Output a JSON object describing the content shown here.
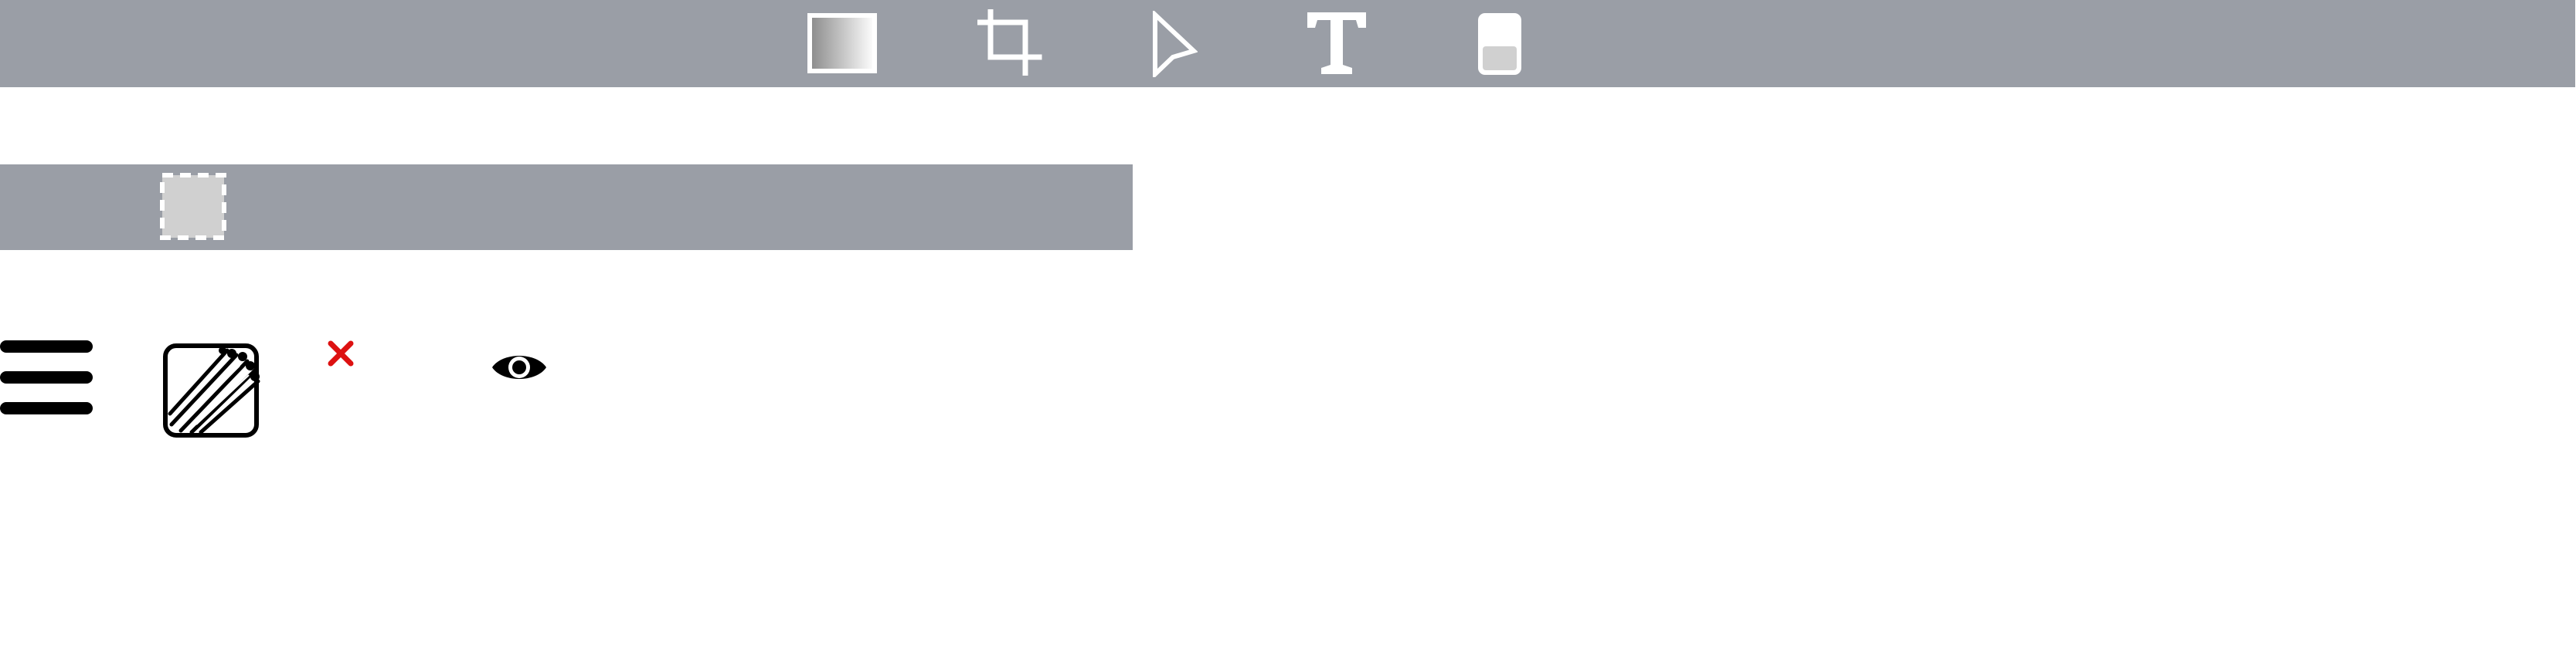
{
  "colors": {
    "toolbar_background": "#9a9ea6",
    "page_background": "#ffffff",
    "icon_white": "#ffffff",
    "icon_black": "#000000",
    "close_red": "#dd1111",
    "placeholder_gray": "#d0d0d0"
  },
  "toolbar_top": {
    "tools": [
      {
        "icon": "gradient-rectangle-icon"
      },
      {
        "icon": "crop-icon"
      },
      {
        "icon": "pointer-icon"
      },
      {
        "icon": "text-icon"
      },
      {
        "icon": "fill-level-icon"
      }
    ]
  },
  "toolbar_second": {
    "tools": [
      {
        "icon": "selection-marquee-icon"
      }
    ]
  },
  "icon_row": {
    "items": [
      {
        "icon": "hamburger-menu-icon"
      },
      {
        "icon": "pencils-bundle-icon"
      },
      {
        "icon": "close-icon"
      },
      {
        "icon": "eye-icon"
      }
    ]
  }
}
